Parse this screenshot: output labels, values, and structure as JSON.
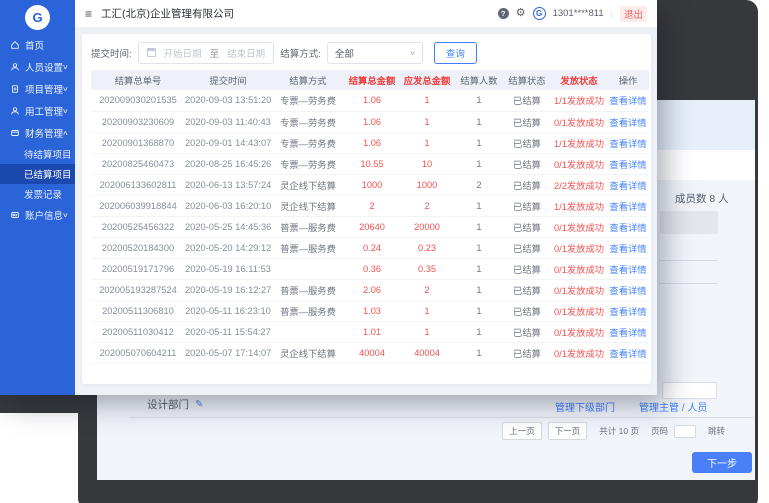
{
  "topbar": {
    "title": "工汇(北京)企业管理有限公司",
    "phone": "1301****811",
    "divider": "|",
    "logout_label": "退出"
  },
  "sidebar": {
    "logo_letter": "G",
    "items": [
      {
        "label": "首页",
        "icon": "home-icon",
        "type": "main"
      },
      {
        "label": "人员设置",
        "icon": "user-icon",
        "type": "main",
        "chevron": "down"
      },
      {
        "label": "项目管理",
        "icon": "project-icon",
        "type": "main",
        "chevron": "down"
      },
      {
        "label": "用工管理",
        "icon": "worker-icon",
        "type": "main",
        "chevron": "down"
      },
      {
        "label": "财务管理",
        "icon": "finance-icon",
        "type": "main",
        "chevron": "up"
      },
      {
        "label": "待结算项目",
        "type": "sub"
      },
      {
        "label": "已结算项目",
        "type": "sub",
        "active": true
      },
      {
        "label": "发票记录",
        "type": "sub"
      },
      {
        "label": "账户信息",
        "icon": "account-icon",
        "type": "main",
        "chevron": "down"
      }
    ]
  },
  "filters": {
    "time_label": "提交时间:",
    "start_placeholder": "开始日期",
    "to_label": "至",
    "end_placeholder": "结束日期",
    "method_label": "结算方式:",
    "method_value": "全部",
    "search_label": "查询"
  },
  "table": {
    "headers": [
      "结算总单号",
      "提交时间",
      "结算方式",
      "结算总金额",
      "应发总金额",
      "结算人数",
      "结算状态",
      "发放状态",
      "操作"
    ],
    "red_header_indexes": [
      3,
      4,
      7
    ],
    "action_label": "查看详情",
    "rows": [
      {
        "id": "202009030201535",
        "time": "2020-09-03 13:51:20",
        "method": "专票—劳务费",
        "settle_amount": "1.06",
        "pay_amount": "1",
        "people": "1",
        "settle_status": "已结算",
        "dispatch_status": "1/1发放成功"
      },
      {
        "id": "20200903230609",
        "time": "2020-09-03 11:40:43",
        "method": "专票—劳务费",
        "settle_amount": "1.06",
        "pay_amount": "1",
        "people": "1",
        "settle_status": "已结算",
        "dispatch_status": "0/1发放成功"
      },
      {
        "id": "20200901368870",
        "time": "2020-09-01 14:43:07",
        "method": "专票—劳务费",
        "settle_amount": "1.06",
        "pay_amount": "1",
        "people": "1",
        "settle_status": "已结算",
        "dispatch_status": "1/1发放成功"
      },
      {
        "id": "20200825460473",
        "time": "2020-08-25 16:45:26",
        "method": "专票—劳务费",
        "settle_amount": "10.55",
        "pay_amount": "10",
        "people": "1",
        "settle_status": "已结算",
        "dispatch_status": "0/1发放成功"
      },
      {
        "id": "202006133602811",
        "time": "2020-06-13 13:57:24",
        "method": "灵企线下结算",
        "settle_amount": "1000",
        "pay_amount": "1000",
        "people": "2",
        "settle_status": "已结算",
        "dispatch_status": "2/2发放成功"
      },
      {
        "id": "202006039918844",
        "time": "2020-06-03 16:20:10",
        "method": "灵企线下结算",
        "settle_amount": "2",
        "pay_amount": "2",
        "people": "1",
        "settle_status": "已结算",
        "dispatch_status": "1/1发放成功"
      },
      {
        "id": "20200525456322",
        "time": "2020-05-25 14:45:36",
        "method": "普票—服务费",
        "settle_amount": "20640",
        "pay_amount": "20000",
        "people": "1",
        "settle_status": "已结算",
        "dispatch_status": "0/1发放成功"
      },
      {
        "id": "20200520184300",
        "time": "2020-05-20 14:29:12",
        "method": "普票—服务费",
        "settle_amount": "0.24",
        "pay_amount": "0.23",
        "people": "1",
        "settle_status": "已结算",
        "dispatch_status": "0/1发放成功"
      },
      {
        "id": "20200519171796",
        "time": "2020-05-19 16:11:53",
        "method": "",
        "settle_amount": "0.36",
        "pay_amount": "0.35",
        "people": "1",
        "settle_status": "已结算",
        "dispatch_status": "0/1发放成功"
      },
      {
        "id": "202005193287524",
        "time": "2020-05-19 16:12:27",
        "method": "普票—服务费",
        "settle_amount": "2.06",
        "pay_amount": "2",
        "people": "1",
        "settle_status": "已结算",
        "dispatch_status": "0/1发放成功"
      },
      {
        "id": "20200511306810",
        "time": "2020-05-11 16:23:10",
        "method": "普票—服务费",
        "settle_amount": "1.03",
        "pay_amount": "1",
        "people": "1",
        "settle_status": "已结算",
        "dispatch_status": "0/1发放成功"
      },
      {
        "id": "20200511030412",
        "time": "2020-05-11 15:54:27",
        "method": "",
        "settle_amount": "1.01",
        "pay_amount": "1",
        "people": "1",
        "settle_status": "已结算",
        "dispatch_status": "0/1发放成功"
      },
      {
        "id": "202005070604211",
        "time": "2020-05-07 17:14:07",
        "method": "灵企线下结算",
        "settle_amount": "40004",
        "pay_amount": "40004",
        "people": "1",
        "settle_status": "已结算",
        "dispatch_status": "0/1发放成功"
      }
    ]
  },
  "background": {
    "member_count": "成员数 8 人",
    "dept_name": "设计部门",
    "links": [
      "管理下级部门",
      "管理主管 / 人员"
    ],
    "pagination": {
      "prev": "上一页",
      "next": "下一页",
      "total": "共计 10 页",
      "goto_label": "页码",
      "jump_label": "跳转"
    },
    "next_step": "下一步"
  },
  "colors": {
    "sidebar_blue": "#2b64d8",
    "sidebar_active": "#1b49b0",
    "accent_blue": "#4080ff",
    "alert_red": "#ee3f3f",
    "frame_dark": "#38393d"
  }
}
